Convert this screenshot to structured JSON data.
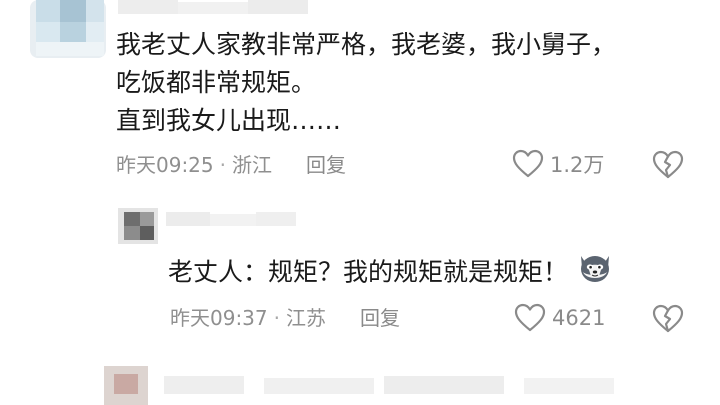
{
  "comment1": {
    "text_lines": [
      "我老丈人家教非常严格，我老婆，我小舅子，",
      "吃饭都非常规矩。",
      "直到我女儿出现……"
    ],
    "time": "昨天09:25",
    "location": "浙江",
    "reply_label": "回复",
    "like_count": "1.2万",
    "icons": {
      "like": "heart-outline-icon",
      "dislike": "broken-heart-icon"
    }
  },
  "reply1": {
    "text": "老丈人：规矩？我的规矩就是规矩！",
    "emoji": "wolf-face-emoji",
    "time": "昨天09:37",
    "location": "江苏",
    "reply_label": "回复",
    "like_count": "4621"
  },
  "separator": "·",
  "colors": {
    "text": "#1a1a1a",
    "meta": "#8f8f8f",
    "background": "#ffffff"
  }
}
